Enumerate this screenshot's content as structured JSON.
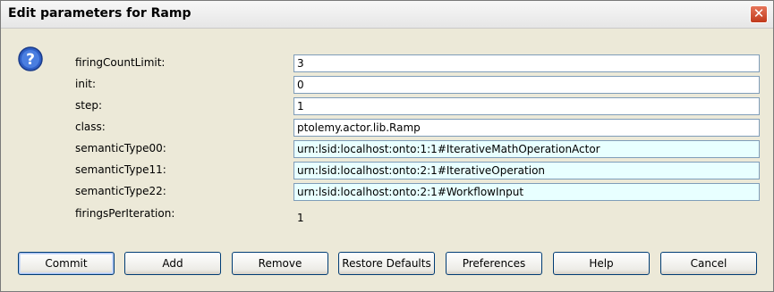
{
  "window": {
    "title": "Edit parameters for Ramp",
    "close_label": "✕"
  },
  "params": [
    {
      "label": "firingCountLimit:",
      "value": "3"
    },
    {
      "label": "init:",
      "value": "0"
    },
    {
      "label": "step:",
      "value": "1"
    },
    {
      "label": "class:",
      "value": "ptolemy.actor.lib.Ramp"
    },
    {
      "label": "semanticType00:",
      "value": "urn:lsid:localhost:onto:1:1#IterativeMathOperationActor"
    },
    {
      "label": "semanticType11:",
      "value": "urn:lsid:localhost:onto:2:1#IterativeOperation"
    },
    {
      "label": "semanticType22:",
      "value": "urn:lsid:localhost:onto:2:1#WorkflowInput"
    },
    {
      "label": "firingsPerIteration:",
      "value": "1"
    }
  ],
  "buttons": {
    "commit": "Commit",
    "add": "Add",
    "remove": "Remove",
    "restore_defaults": "Restore Defaults",
    "preferences": "Preferences",
    "help": "Help",
    "cancel": "Cancel"
  },
  "icons": {
    "help": "question-icon"
  },
  "colors": {
    "field_tint": "#e8ffff",
    "button_border": "#003c74"
  }
}
